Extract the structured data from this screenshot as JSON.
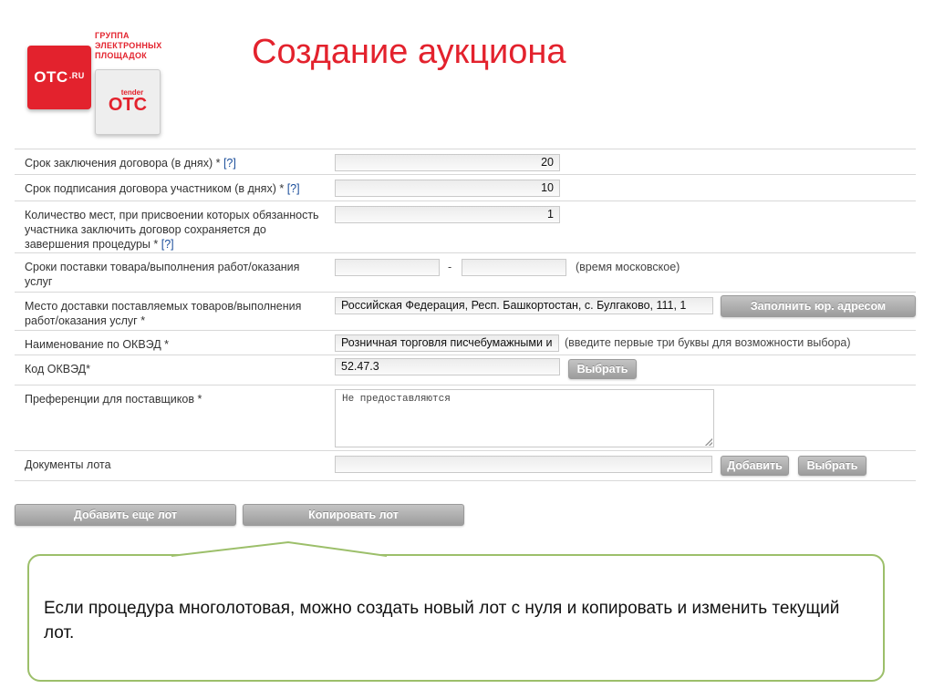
{
  "logo": {
    "ots_text": "OTC",
    "ots_suffix": ".RU",
    "group_line1": "ГРУППА",
    "group_line2": "ЭЛЕКТРОННЫХ",
    "group_line3": "ПЛОЩАДОК",
    "tender_small": "tender",
    "tender_big": "OTC"
  },
  "title": "Создание аукциона",
  "form": {
    "contract_term": {
      "label": "Срок заключения договора (в днях) *",
      "help": "[?]",
      "value": "20"
    },
    "signing_term": {
      "label": "Срок подписания договора участником (в днях) *",
      "help": "[?]",
      "value": "10"
    },
    "places_count": {
      "label": "Количество мест, при присвоении которых обязанность участника заключить договор сохраняется до завершения процедуры *",
      "help": "[?]",
      "value": "1"
    },
    "delivery_period": {
      "label": "Сроки поставки товара/выполнения работ/оказания услуг",
      "separator": "-",
      "hint": "(время московское)",
      "from": "",
      "to": ""
    },
    "delivery_place": {
      "label": "Место доставки поставляемых товаров/выполнения работ/оказания услуг *",
      "value": "Российская Федерация, Респ. Башкортостан, с. Булгаково, 111, 1",
      "button": "Заполнить юр. адресом"
    },
    "okved_name": {
      "label": "Наименование по ОКВЭД *",
      "value": "Розничная торговля писчебумажными и",
      "hint": "(введите первые три буквы для возможности выбора)"
    },
    "okved_code": {
      "label": "Код ОКВЭД*",
      "value": "52.47.3",
      "button": "Выбрать"
    },
    "preferences": {
      "label": "Преференции для поставщиков *",
      "value": "Не предоставляются"
    },
    "documents": {
      "label": "Документы лота",
      "value": "",
      "add_button": "Добавить",
      "select_button": "Выбрать"
    }
  },
  "actions": {
    "add_lot": "Добавить еще лот",
    "copy_lot": "Копировать лот"
  },
  "callout": {
    "text": "Если процедура многолотовая, можно создать новый лот с нуля и копировать и изменить текущий лот."
  },
  "colors": {
    "brand": "#e3222d",
    "callout_border": "#9cbf6a",
    "button": "#a8a8a8"
  }
}
